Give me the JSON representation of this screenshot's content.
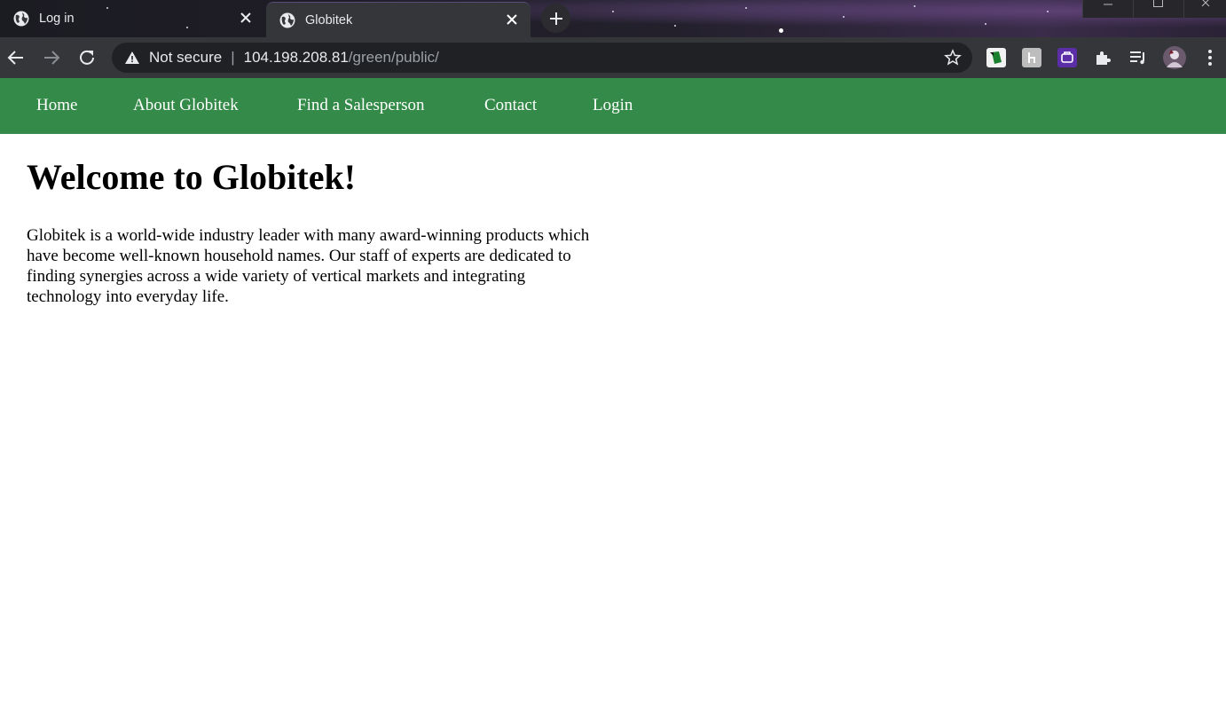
{
  "browser": {
    "tabs": [
      {
        "title": "Log in",
        "active": false
      },
      {
        "title": "Globitek",
        "active": true
      }
    ],
    "address": {
      "security_label": "Not secure",
      "host": "104.198.208.81",
      "path": "/green/public/"
    },
    "colors": {
      "frame": "#202124",
      "toolbar": "#35363a",
      "omnibox": "#202124"
    }
  },
  "site": {
    "nav": [
      "Home",
      "About Globitek",
      "Find a Salesperson",
      "Contact",
      "Login"
    ],
    "heading": "Welcome to Globitek!",
    "intro": "Globitek is a world-wide industry leader with many award-winning products which have become well-known household names. Our staff of experts are dedicated to finding synergies across a wide variety of vertical markets and integrating technology into everyday life.",
    "colors": {
      "nav_bg": "#348a48",
      "nav_text": "#ffffff"
    }
  }
}
